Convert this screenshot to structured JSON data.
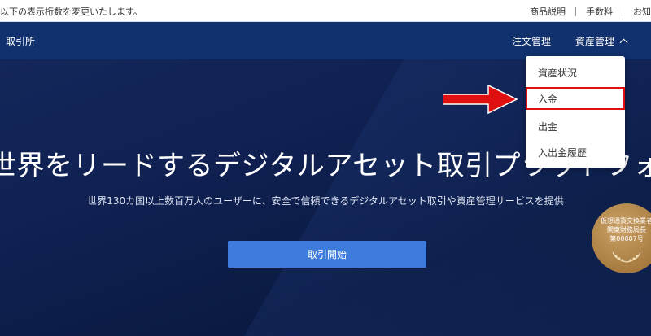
{
  "topbar": {
    "notice": "以下の表示桁数を変更いたします。",
    "links": [
      "商品説明",
      "手数料",
      "お知"
    ]
  },
  "navbar": {
    "brand": "取引所",
    "order_management": "注文管理",
    "asset_management": "資産管理"
  },
  "dropdown": {
    "items": [
      "資産状況",
      "入金",
      "出金",
      "入出金履歴"
    ],
    "highlighted": "入金"
  },
  "hero": {
    "title": "世界をリードするデジタルアセット取引プラットフォーム",
    "subtitle": "世界130カ国以上数百万人のユーザーに、安全で信頼できるデジタルアセット取引や資産管理サービスを提供",
    "cta": "取引開始"
  },
  "badge": {
    "lines": [
      "仮想通貨交換業者",
      "関東財務局長",
      "第00007号"
    ]
  },
  "colors": {
    "navbar": "#11306e",
    "cta": "#3d7cdc",
    "highlight": "#e01010",
    "badge": "#a87c40"
  }
}
